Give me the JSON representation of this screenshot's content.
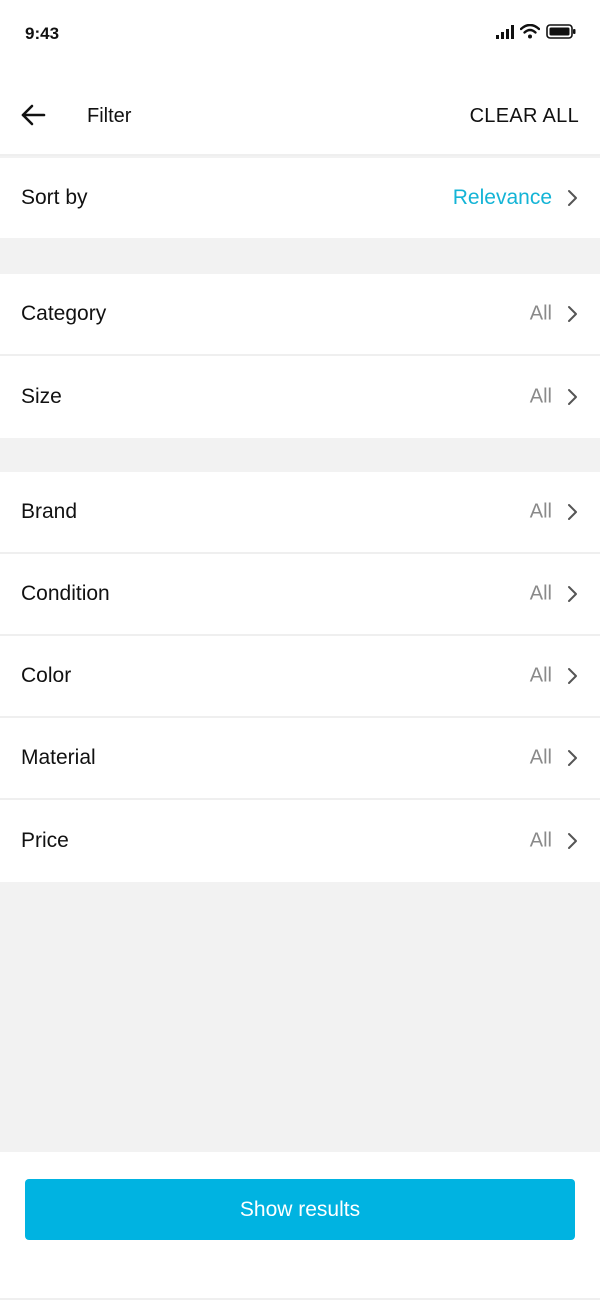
{
  "status_bar": {
    "time": "9:43"
  },
  "header": {
    "title": "Filter",
    "clear_all_label": "CLEAR ALL"
  },
  "sort": {
    "label": "Sort by",
    "value": "Relevance"
  },
  "group_primary": [
    {
      "label": "Category",
      "value": "All"
    },
    {
      "label": "Size",
      "value": "All"
    }
  ],
  "group_secondary": [
    {
      "label": "Brand",
      "value": "All"
    },
    {
      "label": "Condition",
      "value": "All"
    },
    {
      "label": "Color",
      "value": "All"
    },
    {
      "label": "Material",
      "value": "All"
    },
    {
      "label": "Price",
      "value": "All"
    }
  ],
  "footer": {
    "show_results_label": "Show results"
  },
  "colors": {
    "accent": "#00b3e1",
    "accent_text": "#14b4d6",
    "muted_value": "#8a8a8a",
    "background": "#f2f2f2"
  },
  "icons": {
    "back": "arrow-left-icon",
    "chevron": "chevron-right-icon",
    "signal": "signal-icon",
    "wifi": "wifi-icon",
    "battery": "battery-icon"
  }
}
